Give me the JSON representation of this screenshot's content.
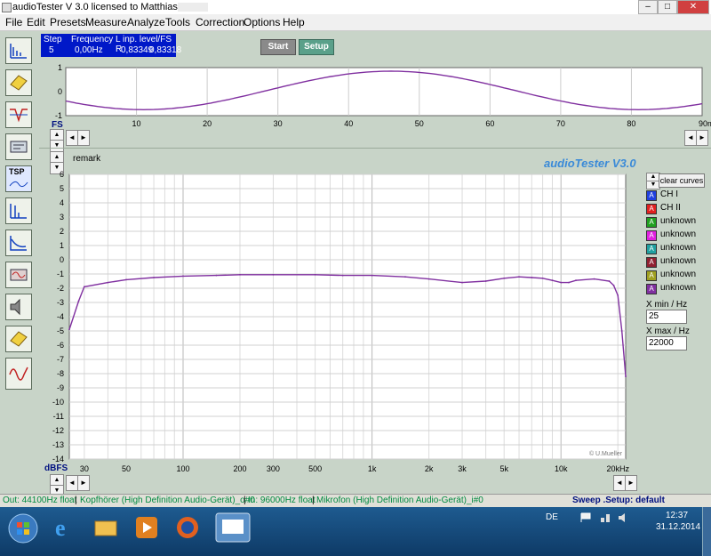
{
  "window": {
    "title": "audioTester  V 3.0   licensed to Matthias",
    "minimize": "–",
    "maximize": "□",
    "close": "✕"
  },
  "menu": [
    "File",
    "Edit",
    "Presets",
    "Measure",
    "Analyze",
    "Tools",
    "Correction",
    "Options",
    "Help"
  ],
  "toolbar_icons": [
    "spectrum-icon",
    "tester-icon",
    "filter-icon",
    "settings-icon",
    "tsp-icon",
    "impulse-icon",
    "response-icon",
    "generator-icon",
    "speaker-icon",
    "eq-icon",
    "waveform-icon"
  ],
  "tsp_label": "TSP",
  "status": {
    "headers": [
      "Step",
      "Frequency",
      "L  inp. level/FS  R"
    ],
    "step": "5",
    "frequency": "0,00Hz",
    "level_l": "0,83349",
    "level_r": "0,83318"
  },
  "buttons": {
    "start": "Start",
    "setup": "Setup"
  },
  "scope": {
    "y_ticks": [
      "1",
      "0",
      "-1"
    ],
    "x_ticks": [
      "10",
      "20",
      "30",
      "40",
      "50",
      "60",
      "70",
      "80"
    ],
    "x_end_label": "90ms",
    "left_label": "FS"
  },
  "remark_label": "remark",
  "brand": "audioTester  V3.0",
  "legend": {
    "clear_button": "clear curves",
    "letter": "A",
    "items": [
      {
        "label": "CH I",
        "color": "#2040e0"
      },
      {
        "label": "CH II",
        "color": "#e02020"
      },
      {
        "label": "unknown",
        "color": "#20a020"
      },
      {
        "label": "unknown",
        "color": "#e020e0"
      },
      {
        "label": "unknown",
        "color": "#20a0a0"
      },
      {
        "label": "unknown",
        "color": "#902030"
      },
      {
        "label": "unknown",
        "color": "#a0a020"
      },
      {
        "label": "unknown",
        "color": "#8030a0"
      }
    ],
    "xmin_label": "X min / Hz",
    "xmin_value": "25",
    "xmax_label": "X max / Hz",
    "xmax_value": "22000"
  },
  "chart_data": {
    "type": "line",
    "xscale": "log",
    "y_unit_label": "dBFS",
    "x_tick_labels": [
      "30",
      "50",
      "100",
      "200",
      "300",
      "500",
      "1k",
      "2k",
      "3k",
      "5k",
      "10k",
      "20kHz"
    ],
    "x_tick_values": [
      30,
      50,
      100,
      200,
      300,
      500,
      1000,
      2000,
      3000,
      5000,
      10000,
      20000
    ],
    "ylim": [
      -14,
      6
    ],
    "xlim": [
      25,
      22000
    ],
    "y_ticks": [
      6,
      5,
      4,
      3,
      2,
      1,
      0,
      -1,
      -2,
      -3,
      -4,
      -5,
      -6,
      -7,
      -8,
      -9,
      -10,
      -11,
      -12,
      -13,
      -14
    ],
    "grid": true,
    "watermark": "© U.Mueller",
    "series": [
      {
        "color": "#8030a0",
        "x": [
          25,
          28,
          30,
          40,
          50,
          70,
          100,
          150,
          200,
          300,
          500,
          700,
          1000,
          1500,
          2000,
          3000,
          4000,
          5000,
          6000,
          7000,
          8000,
          9000,
          10000,
          11000,
          12000,
          15000,
          18000,
          19000,
          20000,
          21000,
          22000
        ],
        "y": [
          -4.9,
          -2.9,
          -1.9,
          -1.6,
          -1.4,
          -1.25,
          -1.15,
          -1.1,
          -1.05,
          -1.05,
          -1.05,
          -1.1,
          -1.1,
          -1.2,
          -1.35,
          -1.6,
          -1.5,
          -1.3,
          -1.2,
          -1.25,
          -1.3,
          -1.45,
          -1.6,
          -1.6,
          -1.45,
          -1.35,
          -1.5,
          -1.8,
          -2.5,
          -5.0,
          -8.2
        ]
      }
    ]
  },
  "statusbar": {
    "out": "Out: 44100Hz float",
    "out_device": "Kopfhörer (High Definition Audio-Gerät)_o#0",
    "in": "In: 96000Hz float",
    "in_device": "Mikrofon (High Definition Audio-Gerät)_i#0",
    "setup": "Sweep  .Setup:  default"
  },
  "taskbar": {
    "language": "DE",
    "time": "12:37",
    "date": "31.12.2014"
  }
}
